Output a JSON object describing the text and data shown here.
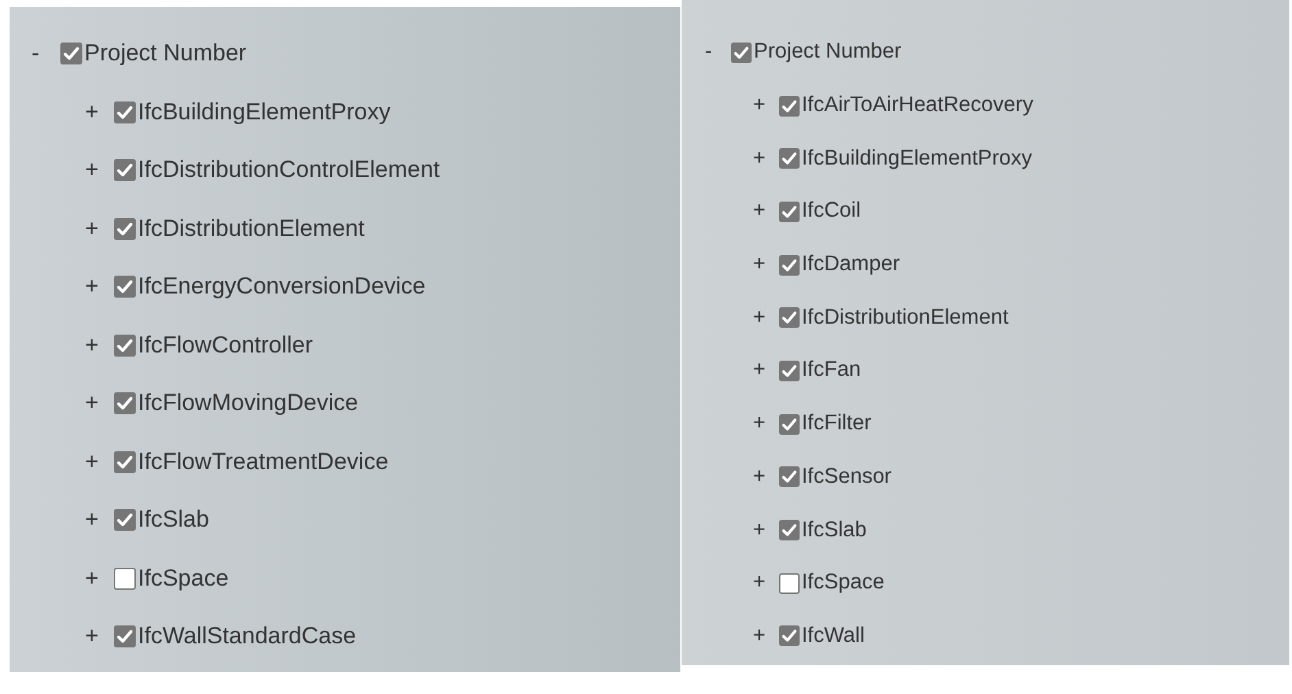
{
  "panels": [
    {
      "tree": {
        "toggle": "-",
        "label": "Project Number",
        "checked": true,
        "children": [
          {
            "toggle": "+",
            "label": "IfcBuildingElementProxy",
            "checked": true
          },
          {
            "toggle": "+",
            "label": "IfcDistributionControlElement",
            "checked": true
          },
          {
            "toggle": "+",
            "label": "IfcDistributionElement",
            "checked": true
          },
          {
            "toggle": "+",
            "label": "IfcEnergyConversionDevice",
            "checked": true
          },
          {
            "toggle": "+",
            "label": "IfcFlowController",
            "checked": true
          },
          {
            "toggle": "+",
            "label": "IfcFlowMovingDevice",
            "checked": true
          },
          {
            "toggle": "+",
            "label": "IfcFlowTreatmentDevice",
            "checked": true
          },
          {
            "toggle": "+",
            "label": "IfcSlab",
            "checked": true
          },
          {
            "toggle": "+",
            "label": "IfcSpace",
            "checked": false
          },
          {
            "toggle": "+",
            "label": "IfcWallStandardCase",
            "checked": true
          }
        ]
      }
    },
    {
      "tree": {
        "toggle": "-",
        "label": "Project Number",
        "checked": true,
        "children": [
          {
            "toggle": "+",
            "label": "IfcAirToAirHeatRecovery",
            "checked": true
          },
          {
            "toggle": "+",
            "label": "IfcBuildingElementProxy",
            "checked": true
          },
          {
            "toggle": "+",
            "label": "IfcCoil",
            "checked": true
          },
          {
            "toggle": "+",
            "label": "IfcDamper",
            "checked": true
          },
          {
            "toggle": "+",
            "label": "IfcDistributionElement",
            "checked": true
          },
          {
            "toggle": "+",
            "label": "IfcFan",
            "checked": true
          },
          {
            "toggle": "+",
            "label": "IfcFilter",
            "checked": true
          },
          {
            "toggle": "+",
            "label": "IfcSensor",
            "checked": true
          },
          {
            "toggle": "+",
            "label": "IfcSlab",
            "checked": true
          },
          {
            "toggle": "+",
            "label": "IfcSpace",
            "checked": false
          },
          {
            "toggle": "+",
            "label": "IfcWall",
            "checked": true
          }
        ]
      }
    }
  ]
}
